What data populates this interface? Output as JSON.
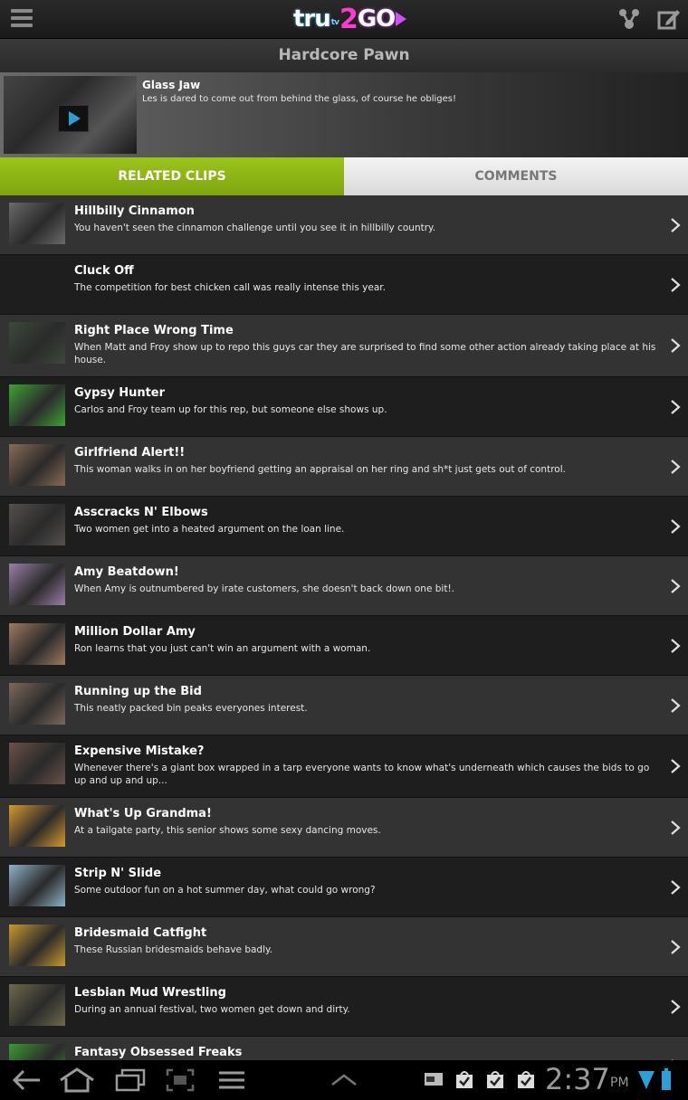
{
  "app": {
    "logo": {
      "tru": "tru",
      "tv": "tv",
      "two": "2",
      "go": "GO"
    },
    "show_title": "Hardcore Pawn"
  },
  "featured": {
    "title": "Glass Jaw",
    "description": "Les is dared to come out from behind the glass, of course he obliges!"
  },
  "tabs": [
    {
      "label": "RELATED CLIPS",
      "active": true
    },
    {
      "label": "COMMENTS",
      "active": false
    }
  ],
  "clips": [
    {
      "title": "Hillbilly Cinnamon",
      "description": "You haven't seen the cinnamon challenge until you see it in hillbilly country.",
      "thumb_color": "#6b6a6a"
    },
    {
      "title": "Cluck Off",
      "description": "The competition for best chicken call was really intense this year.",
      "thumb_color": ""
    },
    {
      "title": "Right Place Wrong Time",
      "description": "When Matt and Froy show up to repo this guys car they are surprised to find some other action already taking place at his house.",
      "thumb_color": "#3c4a3a"
    },
    {
      "title": "Gypsy Hunter",
      "description": "Carlos and Froy team up for this rep, but someone else shows up.",
      "thumb_color": "#3da335"
    },
    {
      "title": "Girlfriend Alert!!",
      "description": "This woman walks in on her boyfriend getting an appraisal on her ring and sh*t just gets out of control.",
      "thumb_color": "#8a6b55"
    },
    {
      "title": "Asscracks N' Elbows",
      "description": "Two women get into a heated argument on the loan line.",
      "thumb_color": "#55504e"
    },
    {
      "title": "Amy Beatdown!",
      "description": "When Amy is outnumbered by irate customers, she doesn't back down one bit!.",
      "thumb_color": "#9a7fa8"
    },
    {
      "title": "Million Dollar Amy",
      "description": "Ron learns that you just can't win an argument with a woman.",
      "thumb_color": "#a07a5e"
    },
    {
      "title": "Running up the Bid",
      "description": "This neatly packed bin peaks everyones interest.",
      "thumb_color": "#7b6a5a"
    },
    {
      "title": "Expensive Mistake?",
      "description": "Whenever there's a giant box wrapped in a tarp everyone wants to know what's underneath which causes the bids to go up and up and up...",
      "thumb_color": "#6a5248"
    },
    {
      "title": "What's Up Grandma!",
      "description": "At a tailgate party, this senior shows some sexy dancing moves.",
      "thumb_color": "#d69a2c"
    },
    {
      "title": "Strip N' Slide",
      "description": "Some outdoor fun on a hot summer day, what could go wrong?",
      "thumb_color": "#8fb1c9"
    },
    {
      "title": "Bridesmaid Catfight",
      "description": "These Russian bridesmaids behave badly.",
      "thumb_color": "#c79a2d"
    },
    {
      "title": "Lesbian Mud Wrestling",
      "description": "During an annual festival, two women get down and dirty.",
      "thumb_color": "#6e6a4a"
    },
    {
      "title": "Fantasy Obsessed Freaks",
      "description": "",
      "thumb_color": "#3b9a33"
    }
  ],
  "status_bar": {
    "time": "2:37",
    "ampm": "PM"
  },
  "colors": {
    "accent_green": "#8fb517",
    "logo_pink": "#ff3bd4"
  }
}
